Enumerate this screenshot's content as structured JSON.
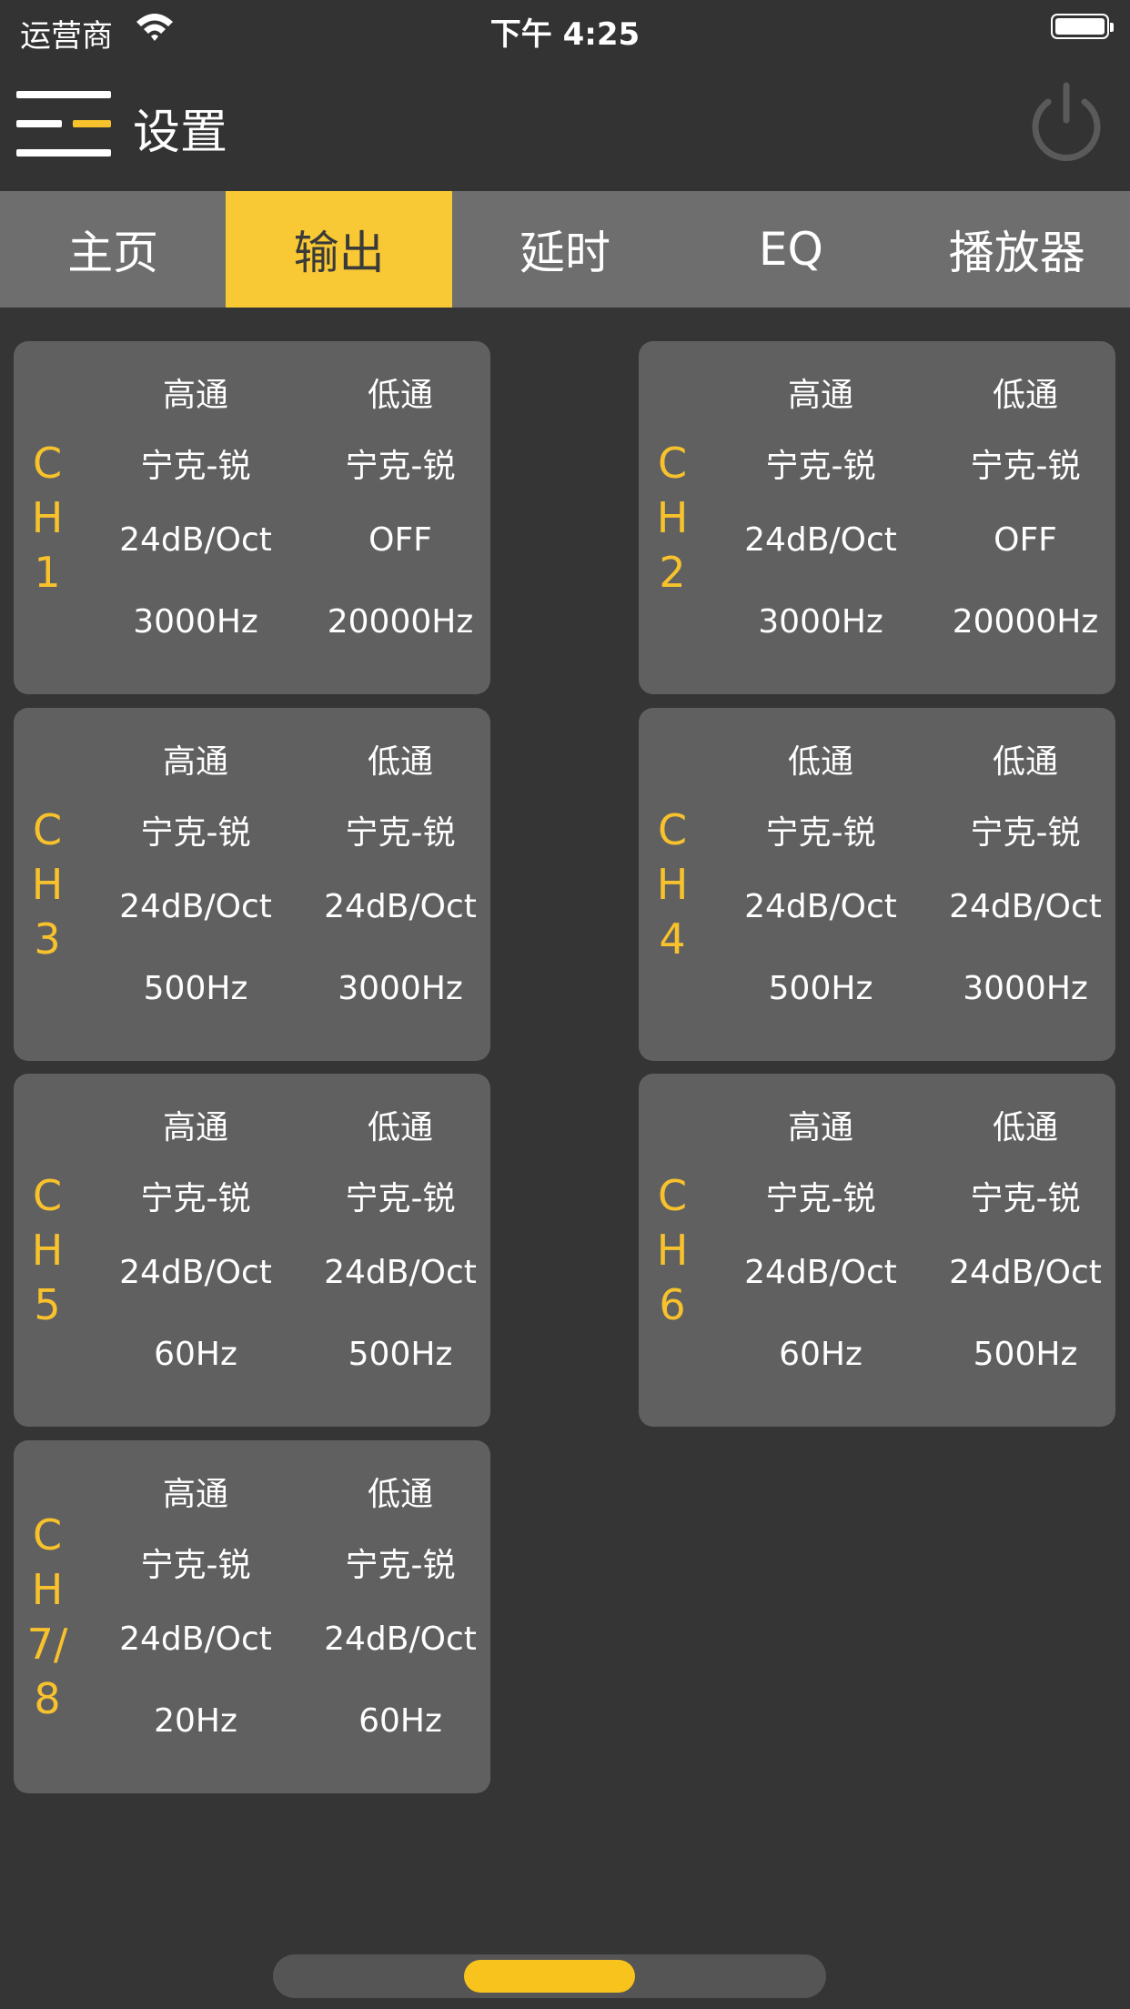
{
  "status_bar": {
    "carrier": "运营商",
    "time": "下午 4:25"
  },
  "header": {
    "title": "设置"
  },
  "tabs": [
    {
      "label": "主页",
      "active": false
    },
    {
      "label": "输出",
      "active": true
    },
    {
      "label": "延时",
      "active": false
    },
    {
      "label": "EQ",
      "active": false
    },
    {
      "label": "播放器",
      "active": false
    }
  ],
  "colors": {
    "accent": "#f8c934",
    "background": "#353535",
    "card": "#606060",
    "tabbar": "#6e6e6e"
  },
  "channels": [
    {
      "label_lines": [
        "C",
        "H",
        "1"
      ],
      "left": {
        "head": "高通",
        "type": "宁克-锐",
        "slope": "24dB/Oct",
        "freq": "3000Hz"
      },
      "right": {
        "head": "低通",
        "type": "宁克-锐",
        "slope": "OFF",
        "freq": "20000Hz"
      }
    },
    {
      "label_lines": [
        "C",
        "H",
        "2"
      ],
      "left": {
        "head": "高通",
        "type": "宁克-锐",
        "slope": "24dB/Oct",
        "freq": "3000Hz"
      },
      "right": {
        "head": "低通",
        "type": "宁克-锐",
        "slope": "OFF",
        "freq": "20000Hz"
      }
    },
    {
      "label_lines": [
        "C",
        "H",
        "3"
      ],
      "left": {
        "head": "高通",
        "type": "宁克-锐",
        "slope": "24dB/Oct",
        "freq": "500Hz"
      },
      "right": {
        "head": "低通",
        "type": "宁克-锐",
        "slope": "24dB/Oct",
        "freq": "3000Hz"
      }
    },
    {
      "label_lines": [
        "C",
        "H",
        "4"
      ],
      "left": {
        "head": "低通",
        "type": "宁克-锐",
        "slope": "24dB/Oct",
        "freq": "500Hz"
      },
      "right": {
        "head": "低通",
        "type": "宁克-锐",
        "slope": "24dB/Oct",
        "freq": "3000Hz"
      }
    },
    {
      "label_lines": [
        "C",
        "H",
        "5"
      ],
      "left": {
        "head": "高通",
        "type": "宁克-锐",
        "slope": "24dB/Oct",
        "freq": "60Hz"
      },
      "right": {
        "head": "低通",
        "type": "宁克-锐",
        "slope": "24dB/Oct",
        "freq": "500Hz"
      }
    },
    {
      "label_lines": [
        "C",
        "H",
        "6"
      ],
      "left": {
        "head": "高通",
        "type": "宁克-锐",
        "slope": "24dB/Oct",
        "freq": "60Hz"
      },
      "right": {
        "head": "低通",
        "type": "宁克-锐",
        "slope": "24dB/Oct",
        "freq": "500Hz"
      }
    },
    {
      "label_lines": [
        "C",
        "H",
        "7/",
        "8"
      ],
      "left": {
        "head": "高通",
        "type": "宁克-锐",
        "slope": "24dB/Oct",
        "freq": "20Hz"
      },
      "right": {
        "head": "低通",
        "type": "宁克-锐",
        "slope": "24dB/Oct",
        "freq": "60Hz"
      }
    }
  ]
}
